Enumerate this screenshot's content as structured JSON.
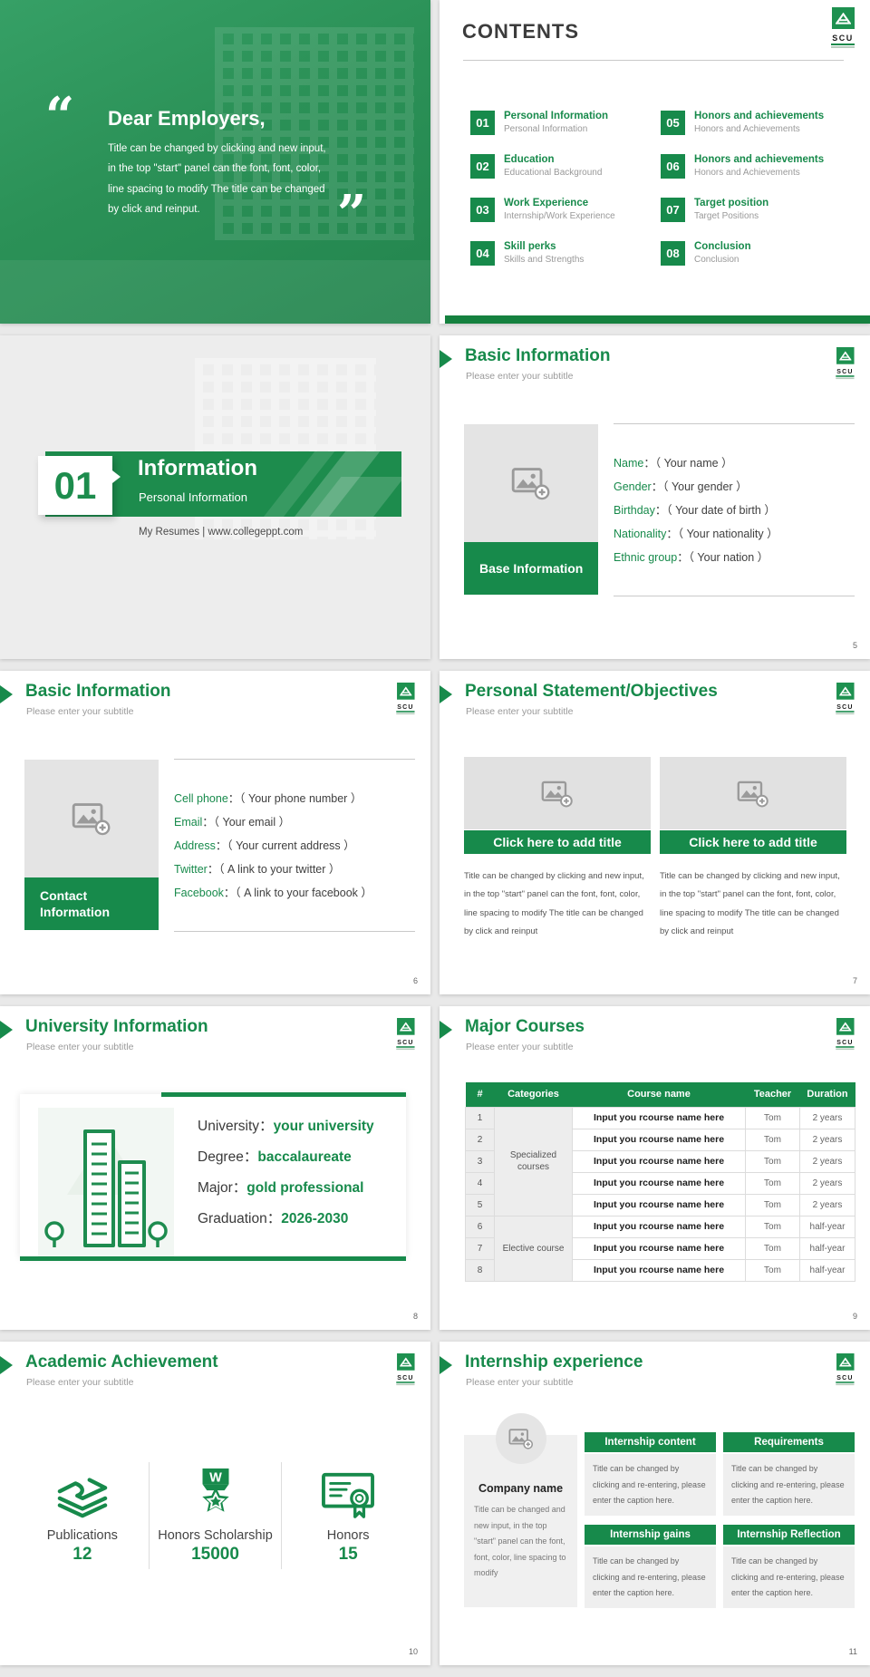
{
  "brand": {
    "logo_text": "SCU",
    "green": "#178a4b"
  },
  "misc": {
    "colon": "："
  },
  "cover": {
    "quote_open": "“",
    "quote_close": "”",
    "title": "Dear Employers,",
    "body": "Title can be changed by clicking and new input, in the top \"start\" panel can the font, font, color, line spacing to modify The title can be changed by click and reinput."
  },
  "contents": {
    "title": "CONTENTS",
    "items": [
      {
        "num": "01",
        "title": "Personal Information",
        "subtitle": "Personal Information"
      },
      {
        "num": "05",
        "title": "Honors and achievements",
        "subtitle": "Honors and Achievements"
      },
      {
        "num": "02",
        "title": "Education",
        "subtitle": "Educational Background"
      },
      {
        "num": "06",
        "title": "Honors and achievements",
        "subtitle": "Honors and Achievements"
      },
      {
        "num": "03",
        "title": "Work Experience",
        "subtitle": "Internship/Work Experience"
      },
      {
        "num": "07",
        "title": "Target position",
        "subtitle": "Target Positions"
      },
      {
        "num": "04",
        "title": "Skill perks",
        "subtitle": "Skills and Strengths"
      },
      {
        "num": "08",
        "title": "Conclusion",
        "subtitle": "Conclusion"
      }
    ]
  },
  "section": {
    "num": "01",
    "title": "Information",
    "subtitle": "Personal Information",
    "footer": "My Resumes | www.collegeppt.com"
  },
  "base_info": {
    "title": "Basic Information",
    "subtitle": "Please enter your subtitle",
    "box_label": "Base Information",
    "rows": [
      {
        "label": "Name",
        "value": "（ Your name ）"
      },
      {
        "label": "Gender",
        "value": "（ Your gender ）"
      },
      {
        "label": "Birthday",
        "value": "（ Your date of birth ）"
      },
      {
        "label": "Nationality",
        "value": "（ Your nationality ）"
      },
      {
        "label": "Ethnic group",
        "value": "（ Your nation ）"
      }
    ],
    "page": "5"
  },
  "contact_info": {
    "title": "Basic Information",
    "subtitle": "Please enter your subtitle",
    "box_label": "Contact Information",
    "rows": [
      {
        "label": "Cell phone",
        "value": "（ Your phone number ）"
      },
      {
        "label": "Email",
        "value": "（ Your email ）"
      },
      {
        "label": "Address",
        "value": "（ Your current address ）"
      },
      {
        "label": "Twitter",
        "value": "（ A link to your twitter ）"
      },
      {
        "label": "Facebook",
        "value": "（ A link to your facebook ）"
      }
    ],
    "page": "6"
  },
  "statement": {
    "title": "Personal Statement/Objectives",
    "subtitle": "Please enter your subtitle",
    "cards": [
      {
        "title": "Click here to add title",
        "body": "Title can be changed by clicking and new input, in the top \"start\" panel can the font, font, color, line spacing to modify The title can be changed by click and reinput"
      },
      {
        "title": "Click here to add title",
        "body": "Title can be changed by clicking and new input, in the top \"start\" panel can the font, font, color, line spacing to modify The title can be changed by click and reinput"
      }
    ],
    "page": "7"
  },
  "university": {
    "title": "University Information",
    "subtitle": "Please enter your subtitle",
    "rows": [
      {
        "label": "University",
        "value": "your university"
      },
      {
        "label": "Degree",
        "value": "baccalaureate"
      },
      {
        "label": "Major",
        "value": "gold professional"
      },
      {
        "label": "Graduation",
        "value": "2026-2030"
      }
    ],
    "page": "8"
  },
  "courses": {
    "title": "Major Courses",
    "subtitle": "Please enter your subtitle",
    "headers": [
      "#",
      "Categories",
      "Course name",
      "Teacher",
      "Duration"
    ],
    "cat_specialized": "Specialized courses",
    "cat_elective": "Elective course",
    "rows": [
      {
        "n": "1",
        "name": "Input you rcourse name here",
        "teacher": "Tom",
        "duration": "2 years"
      },
      {
        "n": "2",
        "name": "Input you rcourse name here",
        "teacher": "Tom",
        "duration": "2 years"
      },
      {
        "n": "3",
        "name": "Input you rcourse name here",
        "teacher": "Tom",
        "duration": "2 years"
      },
      {
        "n": "4",
        "name": "Input you rcourse name here",
        "teacher": "Tom",
        "duration": "2 years"
      },
      {
        "n": "5",
        "name": "Input you rcourse name here",
        "teacher": "Tom",
        "duration": "2 years"
      },
      {
        "n": "6",
        "name": "Input you rcourse name here",
        "teacher": "Tom",
        "duration": "half-year"
      },
      {
        "n": "7",
        "name": "Input you rcourse name here",
        "teacher": "Tom",
        "duration": "half-year"
      },
      {
        "n": "8",
        "name": "Input you rcourse name here",
        "teacher": "Tom",
        "duration": "half-year"
      }
    ],
    "page": "9"
  },
  "academic": {
    "title": "Academic Achievement",
    "subtitle": "Please enter your subtitle",
    "stats": [
      {
        "label": "Publications",
        "value": "12"
      },
      {
        "label": "Honors Scholarship",
        "value": "15000"
      },
      {
        "label": "Honors",
        "value": "15"
      }
    ],
    "page": "10"
  },
  "internship": {
    "title": "Internship experience",
    "subtitle": "Please enter your subtitle",
    "company": {
      "name": "Company name",
      "body": "Title can be changed and new input, in the top \"start\" panel can the font, font, color, line spacing to modify"
    },
    "blocks": [
      {
        "title": "Internship content",
        "body": "Title can be changed by clicking and re-entering, please enter the caption here."
      },
      {
        "title": "Requirements",
        "body": "Title can be changed by clicking and re-entering, please enter the caption here."
      },
      {
        "title": "Internship gains",
        "body": "Title can be changed by clicking and re-entering, please enter the caption here."
      },
      {
        "title": "Internship Reflection",
        "body": "Title can be changed by clicking and re-entering, please enter the caption here."
      }
    ],
    "page": "11"
  }
}
